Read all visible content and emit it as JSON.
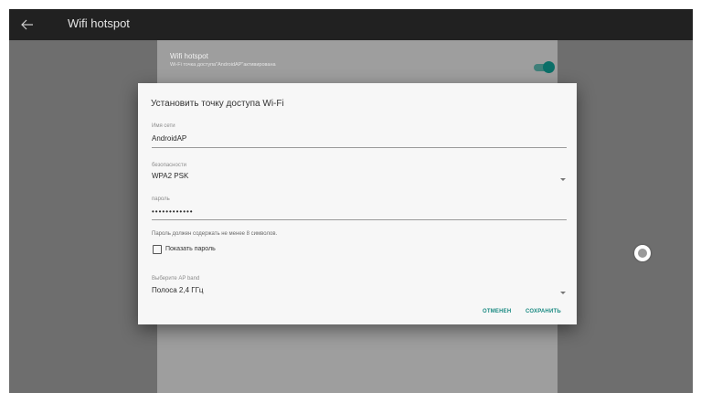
{
  "appbar": {
    "back_icon": "arrow-left-icon",
    "title": "Wifi hotspot"
  },
  "settings": {
    "hotspot_row": {
      "title": "Wifi hotspot",
      "subtitle": "Wi-Fi точка доступа\"AndroidAP\"активирована",
      "toggle_on": true
    }
  },
  "dialog": {
    "title": "Установить точку доступа Wi-Fi",
    "ssid": {
      "label": "Имя сети",
      "value": "AndroidAP"
    },
    "security": {
      "label": "безопасности",
      "value": "WPA2 PSK"
    },
    "password": {
      "label": "пароль",
      "value": "••••••••••••"
    },
    "helper_text": "Пароль должен содержать не менее 8 символов.",
    "show_password": {
      "label": "Показать пароль",
      "checked": false
    },
    "ap_band": {
      "label": "Выберите AP band",
      "value": "Полоса 2,4 ГГц"
    },
    "buttons": {
      "cancel": "ОТМЕНЕН",
      "save": "СОХРАНИТЬ"
    }
  },
  "colors": {
    "accent": "#1a8a82",
    "appbar": "#212121",
    "scrim": "#6e6e6e",
    "dialog_bg": "#f7f7f7"
  }
}
